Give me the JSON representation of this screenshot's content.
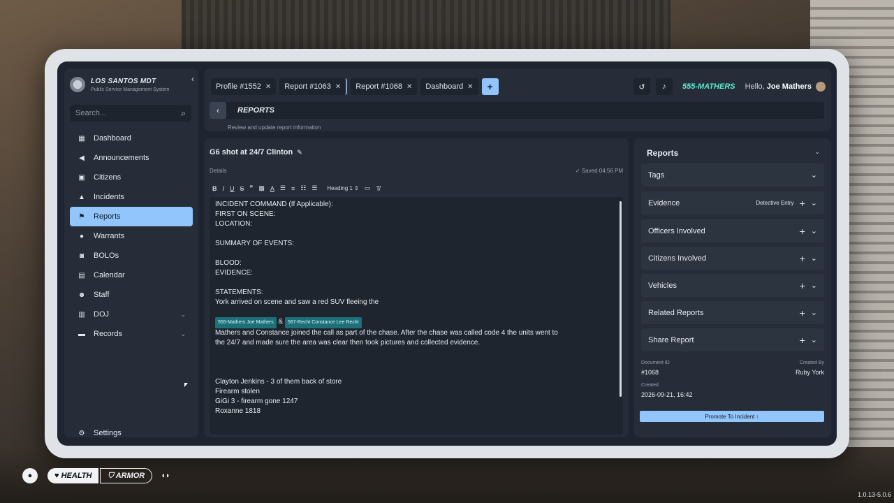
{
  "app": {
    "name": "LOS SANTOS MDT",
    "subtitle": "Public Service Management System"
  },
  "search": {
    "placeholder": "Search..."
  },
  "nav": [
    {
      "label": "Dashboard",
      "icon": "grid-icon"
    },
    {
      "label": "Announcements",
      "icon": "megaphone-icon"
    },
    {
      "label": "Citizens",
      "icon": "id-card-icon"
    },
    {
      "label": "Incidents",
      "icon": "warning-icon"
    },
    {
      "label": "Reports",
      "icon": "flag-icon",
      "active": true
    },
    {
      "label": "Warrants",
      "icon": "location-pin-icon"
    },
    {
      "label": "BOLOs",
      "icon": "binoculars-icon"
    },
    {
      "label": "Calendar",
      "icon": "calendar-icon"
    },
    {
      "label": "Staff",
      "icon": "users-gear-icon"
    },
    {
      "label": "DOJ",
      "icon": "bank-icon",
      "expandable": true
    },
    {
      "label": "Records",
      "icon": "archive-icon",
      "expandable": true
    }
  ],
  "settings_label": "Settings",
  "tabs": [
    {
      "label": "Profile #1552"
    },
    {
      "label": "Report #1063"
    },
    {
      "label": "Report #1068"
    },
    {
      "label": "Dashboard"
    }
  ],
  "user": {
    "callsign": "555-MATHERS",
    "greeting": "Hello,",
    "name": "Joe Mathers"
  },
  "page": {
    "title": "REPORTS",
    "subtitle": "Review and update report information"
  },
  "report": {
    "title": "G6 shot at 24/7 Clinton",
    "details_label": "Details",
    "saved_status": "✓ Saved 04:56 PM",
    "heading_select": "Heading 1",
    "lines": [
      "INCIDENT COMMAND (If Applicable):",
      "FIRST ON SCENE:",
      "LOCATION:",
      "",
      "SUMMARY OF EVENTS:",
      "",
      "BLOOD:",
      "EVIDENCE:",
      "",
      "STATEMENTS:",
      "York arrived on scene and saw a red SUV fleeing the"
    ],
    "mention_a": "555-Mathers Joe Mathers",
    "mention_join": "&",
    "mention_b": "567-Recht Constance Lee Recht",
    "lines2": [
      "Mathers and Constance joined the call as part of the chase. After the chase was called code 4 the units went to",
      "the 24/7 and made sure the area was clear then took pictures and collected evidence.",
      "",
      "",
      "",
      "Clayton Jenkins - 3 of them back of store",
      "Firearm stolen",
      "GiGi 3 - firearm gone  1247",
      "Roxanne 1818"
    ]
  },
  "panel": {
    "title": "Reports",
    "sections": [
      {
        "label": "Tags",
        "plus": false,
        "extra": ""
      },
      {
        "label": "Evidence",
        "plus": true,
        "extra": "Detective Entry"
      },
      {
        "label": "Officers Involved",
        "plus": true,
        "extra": ""
      },
      {
        "label": "Citizens Involved",
        "plus": true,
        "extra": ""
      },
      {
        "label": "Vehicles",
        "plus": true,
        "extra": ""
      },
      {
        "label": "Related Reports",
        "plus": true,
        "extra": ""
      },
      {
        "label": "Share Report",
        "plus": true,
        "extra": ""
      }
    ],
    "meta": {
      "doc_id_label": "Document ID",
      "doc_id": "#1068",
      "created_by_label": "Created By",
      "created_by": "Ruby York",
      "created_label": "Created",
      "created": "2026-09-21, 16:42"
    },
    "promote_label": "Promote To Incident ↑"
  },
  "hud": {
    "health": "HEALTH",
    "armor": "ARMOR"
  },
  "version": "1.0.13-5.0.6",
  "colors": {
    "accent": "#93c5fd",
    "callsign": "#5eead4",
    "panel": "#262d38",
    "mention": "#1d6f78"
  }
}
